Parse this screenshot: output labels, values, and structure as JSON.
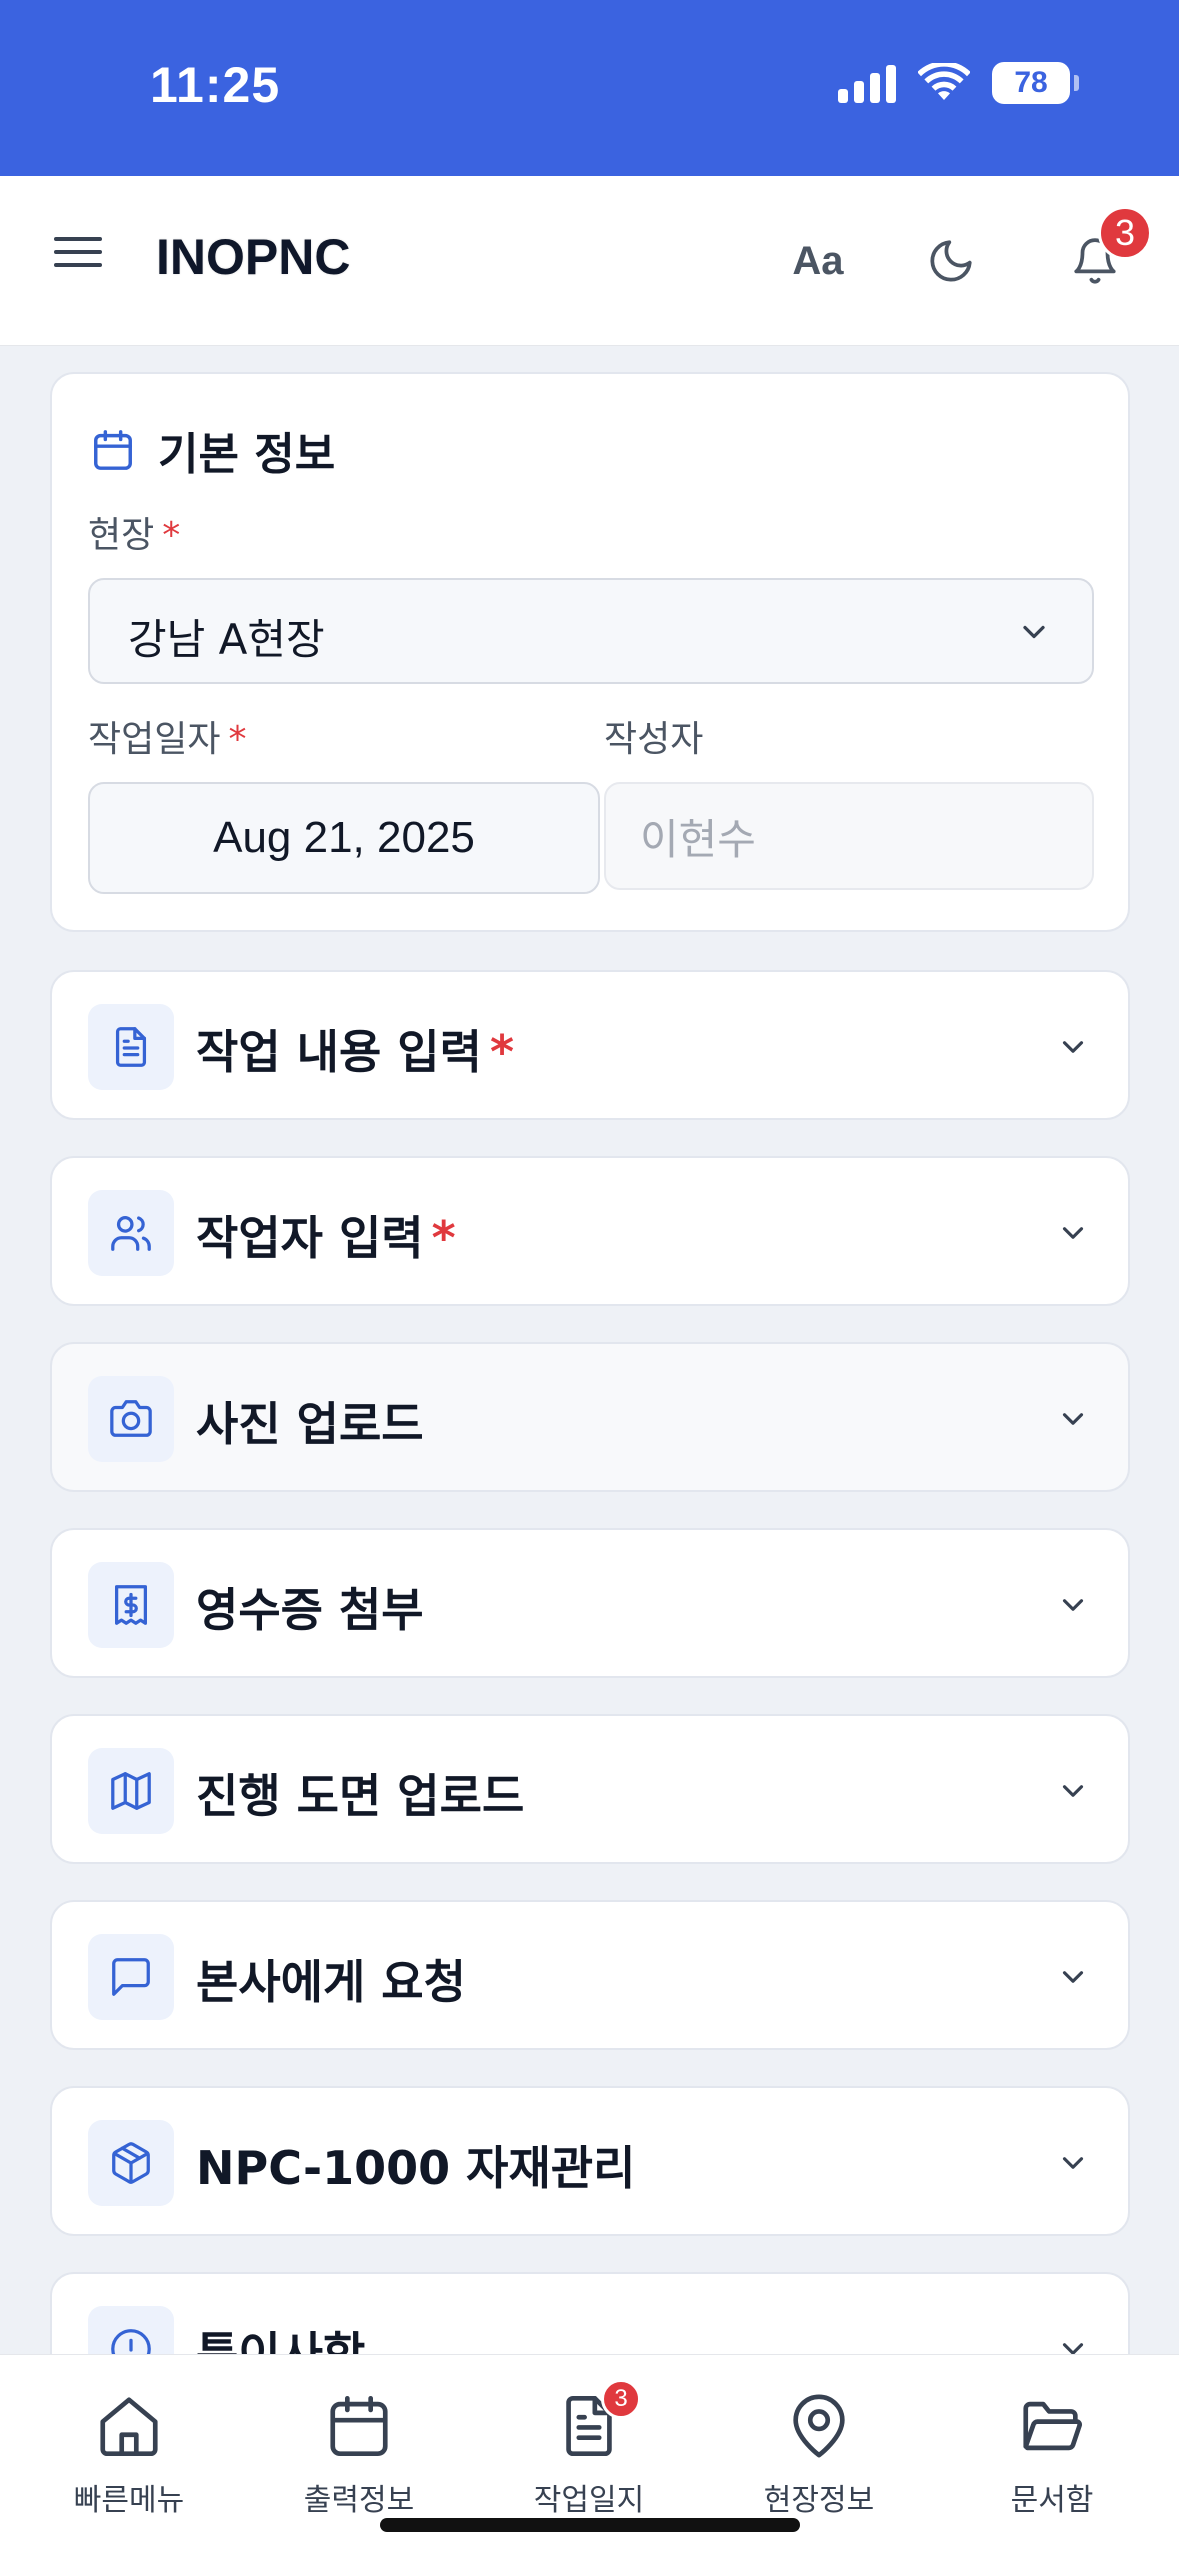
{
  "status_bar": {
    "time": "11:25",
    "battery": "78"
  },
  "header": {
    "title": "INOPNC",
    "font_button_label": "Aa",
    "notification_count": "3"
  },
  "basic_info": {
    "title": "기본 정보",
    "site_label": "현장",
    "site_value": "강남 A현장",
    "date_label": "작업일자",
    "date_value": "Aug 21, 2025",
    "author_label": "작성자",
    "author_placeholder": "이현수",
    "required_mark": "*"
  },
  "sections": [
    {
      "title": "작업 내용 입력",
      "required": true,
      "icon": "document-icon"
    },
    {
      "title": "작업자 입력",
      "required": true,
      "icon": "users-icon"
    },
    {
      "title": "사진 업로드",
      "required": false,
      "icon": "camera-icon"
    },
    {
      "title": "영수증 첨부",
      "required": false,
      "icon": "receipt-icon"
    },
    {
      "title": "진행 도면 업로드",
      "required": false,
      "icon": "map-icon"
    },
    {
      "title": "본사에게 요청",
      "required": false,
      "icon": "message-icon"
    },
    {
      "title": "NPC-1000 자재관리",
      "required": false,
      "icon": "package-icon"
    },
    {
      "title": "특이사항",
      "required": false,
      "icon": "alert-icon"
    }
  ],
  "bottom_nav": {
    "items": [
      {
        "label": "빠른메뉴",
        "icon": "home-icon"
      },
      {
        "label": "출력정보",
        "icon": "calendar-icon"
      },
      {
        "label": "작업일지",
        "icon": "document-icon",
        "badge": "3"
      },
      {
        "label": "현장정보",
        "icon": "map-pin-icon"
      },
      {
        "label": "문서함",
        "icon": "folder-icon"
      }
    ]
  },
  "colors": {
    "brand_blue": "#3b63e0",
    "icon_blue": "#3563d4",
    "required_red": "#e0393e"
  }
}
